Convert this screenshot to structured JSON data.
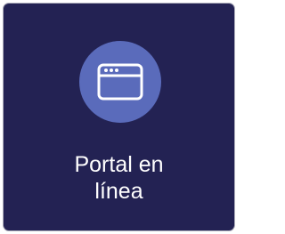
{
  "tile": {
    "label_line1": "Portal en",
    "label_line2": "línea",
    "icon": "browser-window-icon",
    "colors": {
      "background": "#232253",
      "icon_circle": "#5a6bbb",
      "icon_stroke": "#ffffff",
      "text": "#ffffff"
    }
  }
}
